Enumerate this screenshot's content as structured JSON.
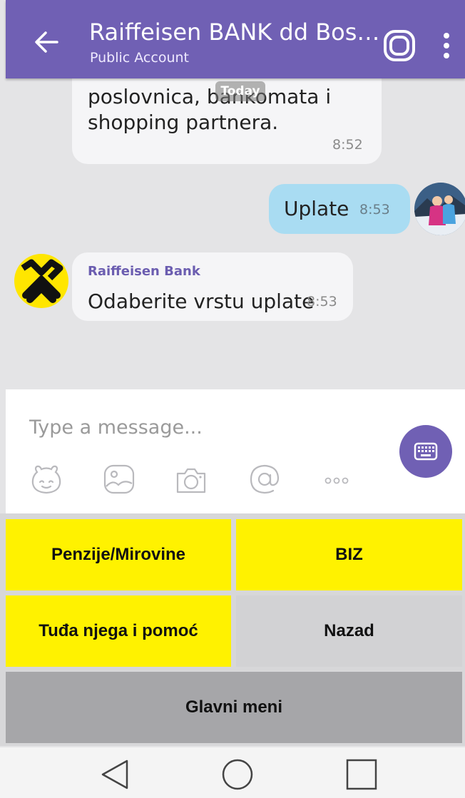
{
  "header": {
    "title": "Raiffeisen BANK dd Bos…",
    "subtitle": "Public Account"
  },
  "chat": {
    "date_chip": "Today",
    "messages": [
      {
        "direction": "incoming",
        "text": "poslovnica, bankomata i shopping partnera.",
        "time": "8:52"
      },
      {
        "direction": "outgoing",
        "text": "Uplate",
        "time": "8:53"
      },
      {
        "direction": "incoming",
        "sender": "Raiffeisen Bank",
        "text": "Odaberite vrstu uplate",
        "time": "8:53"
      }
    ]
  },
  "compose": {
    "placeholder": "Type a message...",
    "icons": [
      "sticker-icon",
      "gallery-icon",
      "camera-icon",
      "mention-icon",
      "more-icon"
    ]
  },
  "keyboard": {
    "buttons": [
      "Penzije/Mirovine",
      "BIZ",
      "Tuđa njega i pomoć",
      "Nazad",
      "Glavni meni"
    ]
  },
  "colors": {
    "header": "#7060b4",
    "bot_button": "#fff200",
    "outgoing_bubble": "#a9dcf2",
    "sender_name": "#6b5db0"
  }
}
